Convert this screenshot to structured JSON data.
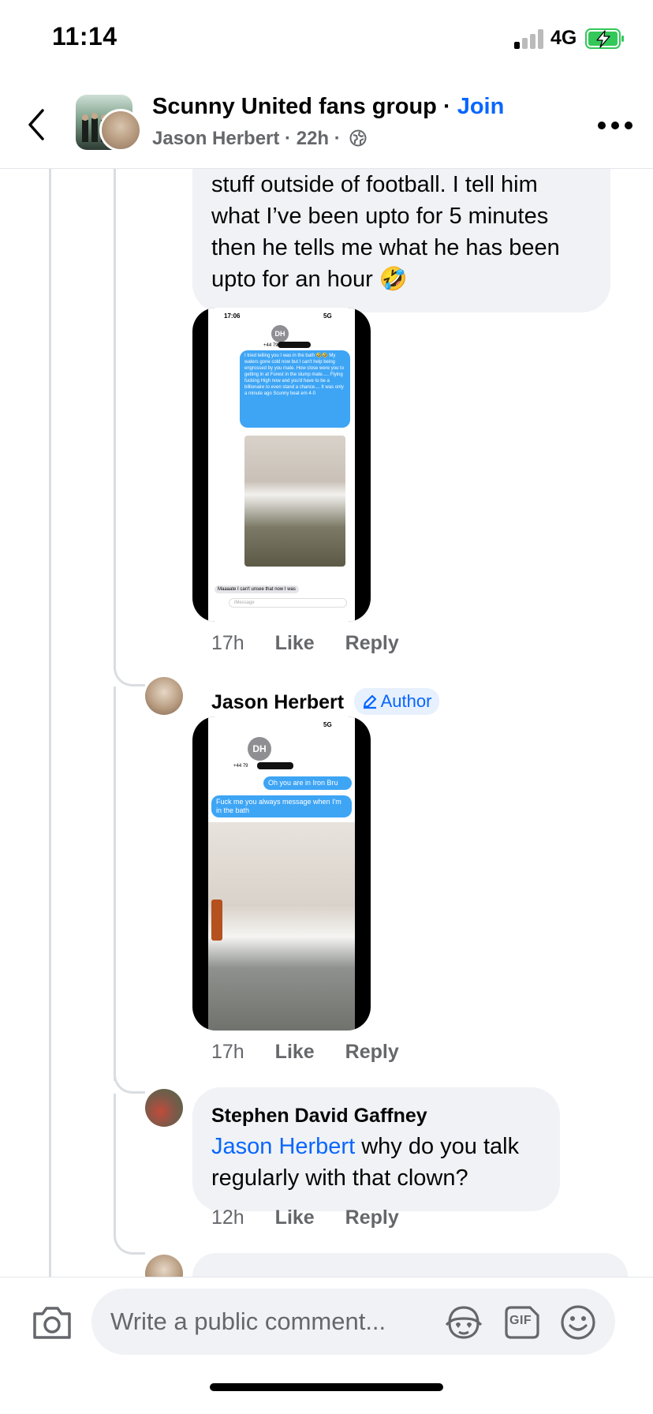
{
  "status_bar": {
    "time": "11:14",
    "network": "4G",
    "accent": "#34c759"
  },
  "header": {
    "group_name": "Scunny United fans group",
    "separator": " · ",
    "join_label": "Join",
    "author": "Jason Herbert",
    "sub_sep": " · ",
    "age": "22h",
    "sub_sep2": " ·",
    "link_color": "#0866ff"
  },
  "comments": {
    "c1": {
      "text": "stuff outside of football. I tell him what I’ve been upto for 5 minutes then he tells me what he has been upto for an hour 🤣",
      "time": "17h",
      "like": "Like",
      "reply": "Reply",
      "screenshot": {
        "status_time": "17:06",
        "initials": "DH",
        "phone_prefix": "+44 79",
        "msg": "I tried telling you I was in the bath 🤣🤣 My waters gone cold now but I can't help being engrossed by you mate. How close were you to getting in at Forest in the slump mate..... Flying fucking High now and you'd have to be a billionaire to even stand a chance.... It was only a minute ago Scunny beat em 4-0",
        "reply_msg": "Maaaate I can't unsee that now I was",
        "imessage_placeholder": "iMessage",
        "network": "5G"
      }
    },
    "c2": {
      "author": "Jason Herbert",
      "badge": "Author",
      "time": "17h",
      "like": "Like",
      "reply": "Reply",
      "screenshot": {
        "initials": "DH",
        "phone_prefix": "+44 79",
        "msg1": "Oh you are in Iron Bru",
        "msg2": "Fuck me you always message when I'm in the bath",
        "network": "5G"
      }
    },
    "c3": {
      "author": "Stephen David Gaffney",
      "mention": "Jason Herbert",
      "text": " why do you talk regularly with that clown?",
      "time": "12h",
      "like": "Like",
      "reply": "Reply"
    }
  },
  "composer": {
    "placeholder": "Write a public comment...",
    "gif_label": "GIF"
  }
}
